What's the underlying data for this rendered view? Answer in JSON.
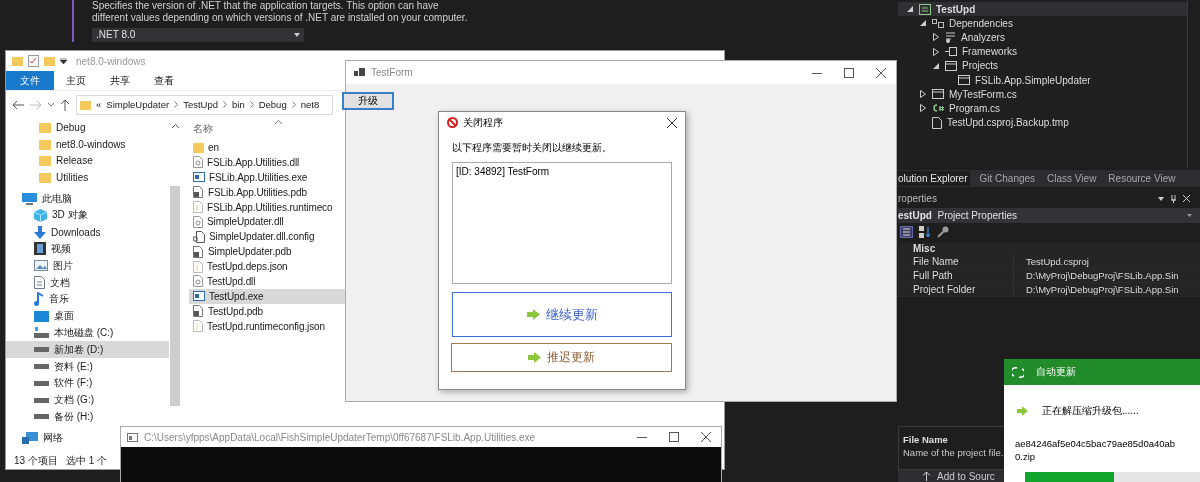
{
  "vs_options": {
    "description_lines": [
      "Specifies the version of .NET that the application targets. This option can have",
      "different values depending on which versions of .NET are installed on your computer."
    ],
    "target_framework": ".NET 8.0"
  },
  "solution_explorer": {
    "tree": [
      {
        "label": "TestUpd",
        "kind": "project",
        "expanded": true,
        "selected": true,
        "children": [
          {
            "label": "Dependencies",
            "kind": "deps",
            "expanded": true,
            "selected": false,
            "children": [
              {
                "label": "Analyzers",
                "kind": "analyzers",
                "expanded": false,
                "selected": false
              },
              {
                "label": "Frameworks",
                "kind": "frameworks",
                "expanded": false,
                "selected": false
              },
              {
                "label": "Projects",
                "kind": "projects",
                "expanded": true,
                "selected": false,
                "children": [
                  {
                    "label": "FSLib.App.SimpleUpdater",
                    "kind": "reference",
                    "selected": false
                  }
                ]
              }
            ]
          },
          {
            "label": "MyTestForm.cs",
            "kind": "form",
            "expanded": false,
            "selected": false
          },
          {
            "label": "Program.cs",
            "kind": "csharp",
            "expanded": false,
            "selected": false
          },
          {
            "label": "TestUpd.csproj.Backup.tmp",
            "kind": "file",
            "selected": false
          }
        ]
      }
    ]
  },
  "tool_tabs": [
    {
      "label": "olution Explorer",
      "selected": true
    },
    {
      "label": "Git Changes",
      "selected": false
    },
    {
      "label": "Class View",
      "selected": false
    },
    {
      "label": "Resource View",
      "selected": false
    }
  ],
  "properties": {
    "title": "roperties",
    "object_name": "estUpd",
    "object_type": "Project Properties",
    "category": "Misc",
    "rows": [
      {
        "name": "File Name",
        "value": "TestUpd.csproj"
      },
      {
        "name": "Full Path",
        "value": "D:\\MyProj\\DebugProj\\FSLib.App.Sin"
      },
      {
        "name": "Project Folder",
        "value": "D:\\MyProj\\DebugProj\\FSLib.App.Sin"
      }
    ],
    "description_title": "File Name",
    "description": "Name of the project file."
  },
  "status_bar": {
    "action": "Add to Sourc"
  },
  "explorer": {
    "title": "net8.0-windows",
    "ribbon_tabs": [
      {
        "label": "文件",
        "selected": true
      },
      {
        "label": "主页",
        "selected": false
      },
      {
        "label": "共享",
        "selected": false
      },
      {
        "label": "查看",
        "selected": false
      }
    ],
    "overflow_mark": "«",
    "path": [
      "SimpleUpdater",
      "TestUpd",
      "bin",
      "Debug",
      "net8"
    ],
    "nav": [
      {
        "label": "Debug",
        "kind": "folder",
        "selected": false
      },
      {
        "label": "net8.0-windows",
        "kind": "folder",
        "selected": false
      },
      {
        "label": "Release",
        "kind": "folder",
        "selected": false
      },
      {
        "label": "Utilities",
        "kind": "folder",
        "selected": false
      },
      {
        "label": "此电脑",
        "kind": "pc",
        "selected": false
      },
      {
        "label": "3D 对象",
        "kind": "cube",
        "selected": false
      },
      {
        "label": "Downloads",
        "kind": "download",
        "selected": false
      },
      {
        "label": "视频",
        "kind": "video",
        "selected": false
      },
      {
        "label": "图片",
        "kind": "picture",
        "selected": false
      },
      {
        "label": "文档",
        "kind": "document",
        "selected": false
      },
      {
        "label": "音乐",
        "kind": "music",
        "selected": false
      },
      {
        "label": "桌面",
        "kind": "desktop",
        "selected": false
      },
      {
        "label": "本地磁盘 (C:)",
        "kind": "system-drive",
        "selected": false
      },
      {
        "label": "新加卷 (D:)",
        "kind": "drive",
        "selected": true
      },
      {
        "label": "资料 (E:)",
        "kind": "drive",
        "selected": false
      },
      {
        "label": "软件 (F:)",
        "kind": "drive",
        "selected": false
      },
      {
        "label": "文档 (G:)",
        "kind": "drive",
        "selected": false
      },
      {
        "label": "备份 (H:)",
        "kind": "drive",
        "selected": false
      },
      {
        "label": "网络",
        "kind": "network",
        "selected": false
      }
    ],
    "column": "名称",
    "files": [
      {
        "name": "en",
        "kind": "folder",
        "selected": false
      },
      {
        "name": "FSLib.App.Utilities.dll",
        "kind": "dll",
        "selected": false
      },
      {
        "name": "FSLib.App.Utilities.exe",
        "kind": "exe",
        "selected": false
      },
      {
        "name": "FSLib.App.Utilities.pdb",
        "kind": "pdb",
        "selected": false
      },
      {
        "name": "FSLib.App.Utilities.runtimeco",
        "kind": "json",
        "selected": false
      },
      {
        "name": "SimpleUpdater.dll",
        "kind": "dll",
        "selected": false
      },
      {
        "name": "SimpleUpdater.dll.config",
        "kind": "config",
        "selected": false
      },
      {
        "name": "SimpleUpdater.pdb",
        "kind": "pdb",
        "selected": false
      },
      {
        "name": "TestUpd.deps.json",
        "kind": "json",
        "selected": false
      },
      {
        "name": "TestUpd.dll",
        "kind": "dll",
        "selected": false
      },
      {
        "name": "TestUpd.exe",
        "kind": "exe",
        "selected": true
      },
      {
        "name": "TestUpd.pdb",
        "kind": "pdb",
        "selected": false
      },
      {
        "name": "TestUpd.runtimeconfig.json",
        "kind": "json",
        "selected": false
      }
    ],
    "item_count": "13 个项目",
    "selection": "选中 1 个"
  },
  "test_form": {
    "title": "TestForm",
    "upgrade_button": "升级"
  },
  "close_dialog": {
    "title": "关闭程序",
    "message": "以下程序需要暂时关闭以继续更新。",
    "processes": [
      "[ID: 34892] TestForm"
    ],
    "continue_button": "继续更新",
    "defer_button": "推迟更新"
  },
  "console": {
    "title": "C:\\Users\\yfpps\\AppData\\Local\\FishSimpleUpdaterTemp\\0ff67687\\FSLib.App.Utilities.exe"
  },
  "update_toast": {
    "title": "自动更新",
    "status": "正在解压缩升级包......",
    "file": "ae84246af5e04c5bac79ae85d0a40ab0.zip",
    "progress": {
      "level": 0.51
    }
  }
}
